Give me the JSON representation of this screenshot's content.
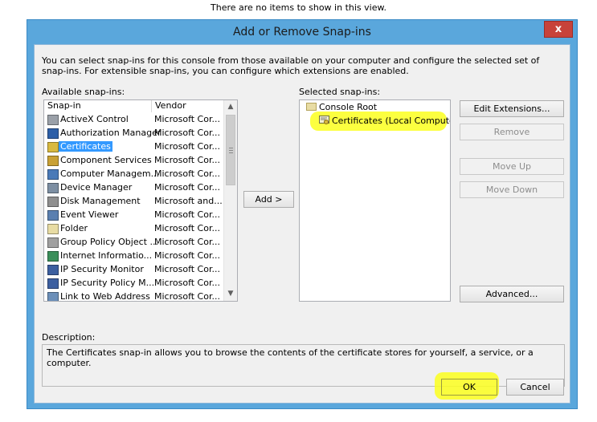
{
  "background_message": "There are no items to show in this view.",
  "dialog": {
    "title": "Add or Remove Snap-ins",
    "close_glyph": "x",
    "intro": "You can select snap-ins for this console from those available on your computer and configure the selected set of snap-ins. For extensible snap-ins, you can configure which extensions are enabled.",
    "available_label": "Available snap-ins:",
    "selected_label": "Selected snap-ins:",
    "columns": [
      "Snap-in",
      "Vendor"
    ],
    "available": [
      {
        "name": "ActiveX Control",
        "vendor": "Microsoft Cor...",
        "icon": "activex-icon"
      },
      {
        "name": "Authorization Manager",
        "vendor": "Microsoft Cor...",
        "icon": "authorization-icon"
      },
      {
        "name": "Certificates",
        "vendor": "Microsoft Cor...",
        "icon": "certificate-icon",
        "selected": true
      },
      {
        "name": "Component Services",
        "vendor": "Microsoft Cor...",
        "icon": "component-services-icon"
      },
      {
        "name": "Computer Managem...",
        "vendor": "Microsoft Cor...",
        "icon": "computer-management-icon"
      },
      {
        "name": "Device Manager",
        "vendor": "Microsoft Cor...",
        "icon": "device-manager-icon"
      },
      {
        "name": "Disk Management",
        "vendor": "Microsoft and...",
        "icon": "disk-icon"
      },
      {
        "name": "Event Viewer",
        "vendor": "Microsoft Cor...",
        "icon": "event-viewer-icon"
      },
      {
        "name": "Folder",
        "vendor": "Microsoft Cor...",
        "icon": "folder-icon"
      },
      {
        "name": "Group Policy Object ...",
        "vendor": "Microsoft Cor...",
        "icon": "group-policy-icon"
      },
      {
        "name": "Internet Informatio...",
        "vendor": "Microsoft Cor...",
        "icon": "iis-icon"
      },
      {
        "name": "IP Security Monitor",
        "vendor": "Microsoft Cor...",
        "icon": "ip-security-icon"
      },
      {
        "name": "IP Security Policy M...",
        "vendor": "Microsoft Cor...",
        "icon": "ip-policy-icon"
      },
      {
        "name": "Link to Web Address",
        "vendor": "Microsoft Cor...",
        "icon": "link-icon"
      }
    ],
    "selected_tree": {
      "root": "Console Root",
      "child": "Certificates (Local Computer)"
    },
    "buttons": {
      "add": "Add >",
      "edit_extensions": "Edit Extensions...",
      "remove": "Remove",
      "move_up": "Move Up",
      "move_down": "Move Down",
      "advanced": "Advanced...",
      "ok": "OK",
      "cancel": "Cancel"
    },
    "description_label": "Description:",
    "description": "The Certificates snap-in allows you to browse the contents of the certificate stores for yourself, a service, or a computer."
  },
  "colors": {
    "title_bar": "#5aa7dc",
    "close_button": "#c7423a",
    "highlight": "#fbff1f",
    "selection": "#3399ff"
  }
}
